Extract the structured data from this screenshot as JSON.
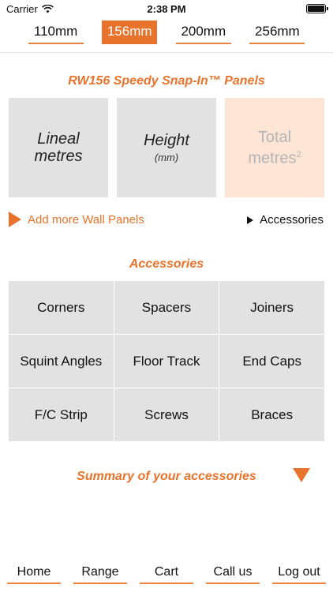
{
  "status_bar": {
    "carrier": "Carrier",
    "time": "2:38 PM"
  },
  "size_tabs": [
    {
      "label": "110mm",
      "active": false
    },
    {
      "label": "156mm",
      "active": true
    },
    {
      "label": "200mm",
      "active": false
    },
    {
      "label": "256mm",
      "active": false
    }
  ],
  "panels": {
    "title": "RW156 Speedy Snap-In™ Panels",
    "lineal": {
      "line1": "Lineal",
      "line2": "metres"
    },
    "height": {
      "label": "Height",
      "unit": "(mm)"
    },
    "total": {
      "line1": "Total",
      "line2": "metres",
      "sup": "2"
    },
    "add_more": "Add more Wall Panels",
    "accessories_link": "Accessories"
  },
  "accessories": {
    "title": "Accessories",
    "items": [
      "Corners",
      "Spacers",
      "Joiners",
      "Squint Angles",
      "Floor Track",
      "End Caps",
      "F/C Strip",
      "Screws",
      "Braces"
    ]
  },
  "summary": {
    "title": "Summary of your accessories"
  },
  "bottom_nav": [
    "Home",
    "Range",
    "Cart",
    "Call us",
    "Log out"
  ],
  "colors": {
    "accent": "#e8732c",
    "tile": "#e2e2e2",
    "total_tile": "#fde5d6"
  },
  "icons": [
    "wifi-icon",
    "battery-icon",
    "play-right-icon",
    "play-right-small-icon",
    "expand-down-icon"
  ]
}
